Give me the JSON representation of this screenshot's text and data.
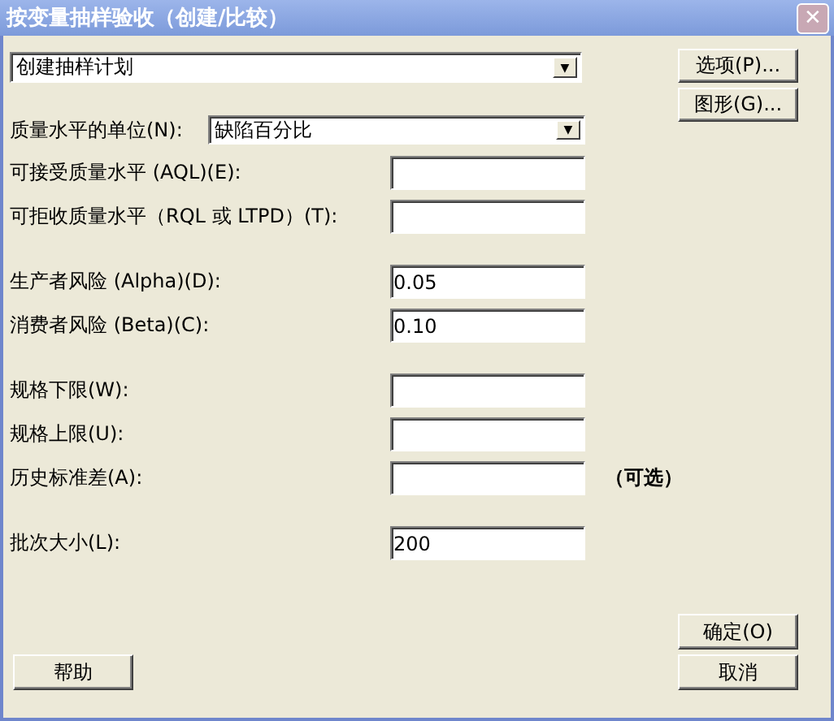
{
  "window": {
    "title": "按变量抽样验收（创建/比较）",
    "close": "✕"
  },
  "mode_dropdown": {
    "value": "创建抽样计划",
    "arrow": "▼"
  },
  "units": {
    "label": "质量水平的单位(N):",
    "value": "缺陷百分比",
    "arrow": "▼"
  },
  "field_groups": [
    [
      {
        "label": "可接受质量水平 (AQL)(E):"
      },
      {
        "label": "可拒收质量水平（RQL 或 LTPD）(T):"
      }
    ],
    [
      {
        "label": "生产者风险 (Alpha)(D):",
        "value": "0.05"
      },
      {
        "label": "消费者风险 (Beta)(C):",
        "value": "0.10"
      }
    ],
    [
      {
        "label": "规格下限(W):"
      },
      {
        "label": "规格上限(U):"
      },
      {
        "label": "历史标准差(A):",
        "note": "（可选）"
      }
    ],
    [
      {
        "label": "批次大小(L):",
        "value": "200"
      }
    ]
  ],
  "side_buttons": [
    "选项(P)...",
    "图形(G)..."
  ],
  "help_button": "帮助",
  "ok_button": "确定(O)",
  "cancel_button": "取消"
}
